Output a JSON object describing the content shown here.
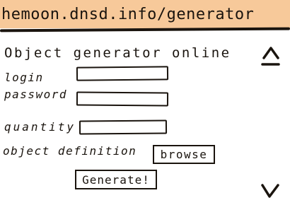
{
  "browser": {
    "url": "hemoon.dnsd.info/generator"
  },
  "page": {
    "title": "Object generator online",
    "login": {
      "label": "login",
      "value": ""
    },
    "password": {
      "label": "password",
      "value": ""
    },
    "quantity": {
      "label": "quantity",
      "value": ""
    },
    "object_definition": {
      "label": "object definition",
      "browse_label": "browse"
    },
    "generate_label": "Generate!"
  },
  "scrollbar": {
    "up_icon": "chevron-up-icon",
    "down_icon": "chevron-down-icon"
  },
  "colors": {
    "url_bar": "#f7c99a",
    "ink": "#1a140e",
    "page_background": "#ffffff"
  }
}
